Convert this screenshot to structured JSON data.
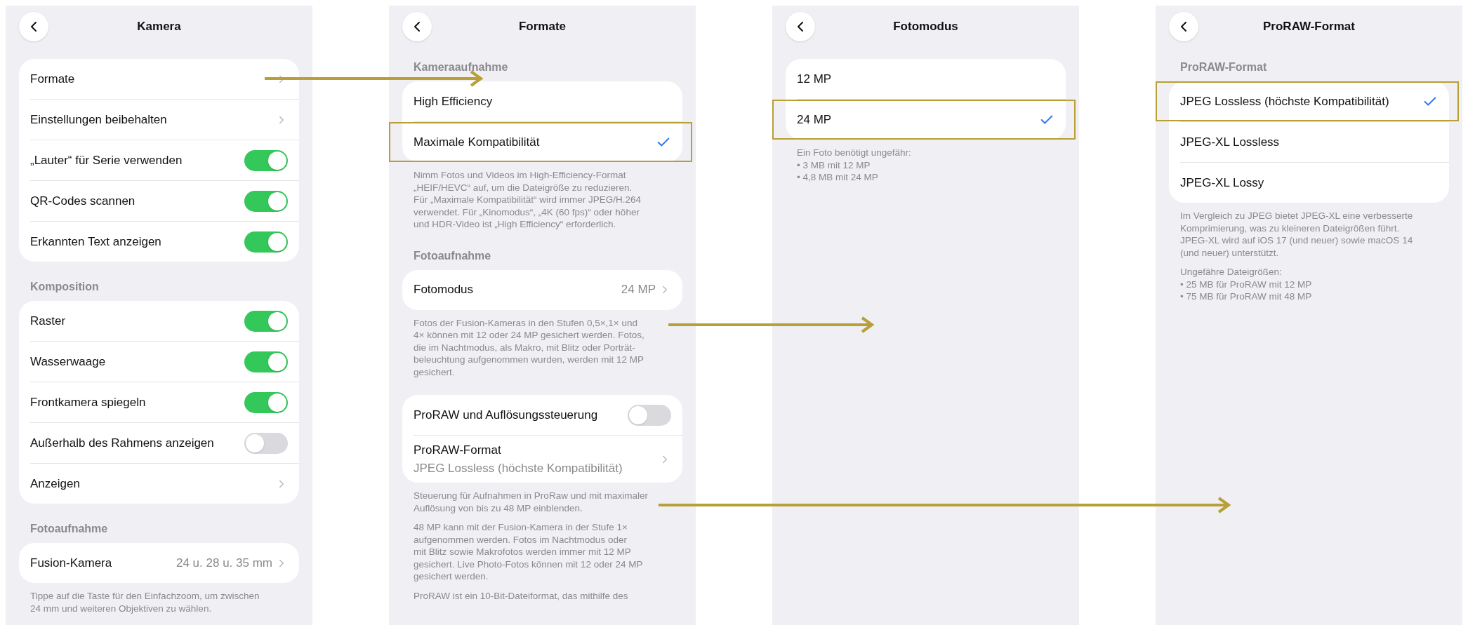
{
  "screens": [
    {
      "title": "Kamera",
      "sections": [
        {
          "rows": [
            {
              "kind": "link",
              "label": "Formate"
            },
            {
              "kind": "link",
              "label": "Einstellungen beibehalten"
            },
            {
              "kind": "toggle",
              "label": "„Lauter“ für Serie verwenden",
              "on": true
            },
            {
              "kind": "toggle",
              "label": "QR-Codes scannen",
              "on": true
            },
            {
              "kind": "toggle",
              "label": "Erkannten Text anzeigen",
              "on": true
            }
          ]
        },
        {
          "header": "Komposition",
          "rows": [
            {
              "kind": "toggle",
              "label": "Raster",
              "on": true
            },
            {
              "kind": "toggle",
              "label": "Wasserwaage",
              "on": true
            },
            {
              "kind": "toggle",
              "label": "Frontkamera spiegeln",
              "on": true
            },
            {
              "kind": "toggle",
              "label": "Außerhalb des Rahmens anzeigen",
              "on": false
            },
            {
              "kind": "link",
              "label": "Anzeigen"
            }
          ]
        },
        {
          "header": "Fotoaufnahme",
          "rows": [
            {
              "kind": "link",
              "label": "Fusion-Kamera",
              "value": "24 u. 28 u. 35 mm"
            }
          ],
          "footer": [
            "Tippe auf die Taste für den Einfachzoom, um zwischen\n24 mm und weiteren Objektiven zu wählen."
          ]
        }
      ]
    },
    {
      "title": "Formate",
      "sections": [
        {
          "header": "Kameraaufnahme",
          "rows": [
            {
              "kind": "option",
              "label": "High Efficiency",
              "selected": false
            },
            {
              "kind": "option",
              "label": "Maximale Kompatibilität",
              "selected": true
            }
          ],
          "footer": [
            "Nimm Fotos und Videos im High-Efficiency-Format\n„HEIF/HEVC“ auf, um die Dateigröße zu reduzieren.\nFür „Maximale Kompatibilität“ wird immer JPEG/H.264\nverwendet. Für „Kinomodus“, „4K (60 fps)“ oder höher\nund HDR-Video ist „High Efficiency“ erforderlich."
          ]
        },
        {
          "header": "Fotoaufnahme",
          "rows": [
            {
              "kind": "link",
              "label": "Fotomodus",
              "value": "24 MP"
            }
          ],
          "footer": [
            "Fotos der Fusion-Kameras in den Stufen 0,5×,1× und\n4× können mit 12 oder 24 MP gesichert werden. Fotos,\ndie im Nachtmodus, als Makro, mit Blitz oder Porträt-\nbeleuchtung aufgenommen wurden, werden mit 12 MP\ngesichert."
          ]
        },
        {
          "rows": [
            {
              "kind": "toggle",
              "label": "ProRAW und Auflösungssteuerung",
              "on": false
            },
            {
              "kind": "link",
              "label": "ProRAW-Format",
              "subtitle": "JPEG Lossless (höchste Kompatibilität)"
            }
          ],
          "footer": [
            "Steuerung für Aufnahmen in ProRaw und mit maximaler\nAuflösung von bis zu 48 MP einblenden.",
            "48 MP kann mit der Fusion-Kamera in der Stufe 1×\naufgenommen werden. Fotos im Nachtmodus oder\nmit Blitz sowie Makrofotos werden immer mit 12 MP\ngesichert. Live Photo-Fotos können mit 12 oder 24 MP\ngesichert werden.",
            "ProRAW ist ein 10-Bit-Dateiformat, das mithilfe des"
          ]
        }
      ]
    },
    {
      "title": "Fotomodus",
      "sections": [
        {
          "rows": [
            {
              "kind": "option",
              "label": "12 MP",
              "selected": false
            },
            {
              "kind": "option",
              "label": "24 MP",
              "selected": true
            }
          ],
          "footer": [
            "Ein Foto benötigt ungefähr:\n• 3 MB mit 12 MP\n• 4,8 MB mit 24 MP"
          ]
        }
      ]
    },
    {
      "title": "ProRAW-Format",
      "sections": [
        {
          "header": "ProRAW-Format",
          "rows": [
            {
              "kind": "option",
              "label": "JPEG Lossless (höchste Kompatibilität)",
              "selected": true
            },
            {
              "kind": "option",
              "label": "JPEG-XL Lossless",
              "selected": false
            },
            {
              "kind": "option",
              "label": "JPEG-XL Lossy",
              "selected": false
            }
          ],
          "footer": [
            "Im Vergleich zu JPEG bietet JPEG-XL eine verbesserte\nKomprimierung, was zu kleineren Dateigrößen führt.\nJPEG-XL wird auf iOS 17 (und neuer) sowie macOS 14\n(und neuer) unterstützt.",
            "Ungefähre Dateigrößen:\n• 25 MB für ProRAW mit 12 MP\n• 75 MB für ProRAW mit 48 MP"
          ]
        }
      ]
    }
  ]
}
